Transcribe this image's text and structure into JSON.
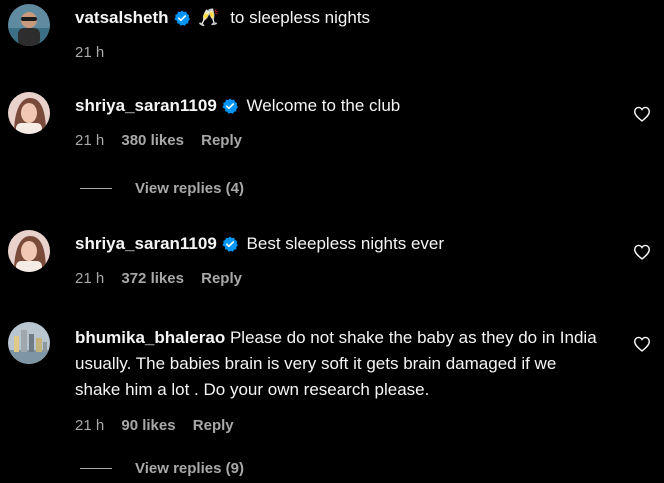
{
  "comments": [
    {
      "username": "vatsalsheth",
      "verified": true,
      "emoji": "🥂",
      "text": "to sleepless nights",
      "time": "21 h",
      "likes": "",
      "reply": ""
    },
    {
      "username": "shriya_saran1109",
      "verified": true,
      "text": "Welcome to the club",
      "time": "21 h",
      "likes": "380 likes",
      "reply": "Reply",
      "view_replies": "View replies (4)"
    },
    {
      "username": "shriya_saran1109",
      "verified": true,
      "text": "Best sleepless nights ever",
      "time": "21 h",
      "likes": "372 likes",
      "reply": "Reply"
    },
    {
      "username": "bhumika_bhalerao",
      "verified": false,
      "text": "Please do not shake the baby as they do in India usually. The babies brain is very soft it gets brain damaged if we shake him a lot . Do your own research please.",
      "time": "21 h",
      "likes": "90 likes",
      "reply": "Reply",
      "view_replies": "View replies (9)"
    }
  ],
  "colors": {
    "background": "#000000",
    "text": "#f5f5f5",
    "muted": "#a8a8a8",
    "verified": "#0095f6"
  }
}
